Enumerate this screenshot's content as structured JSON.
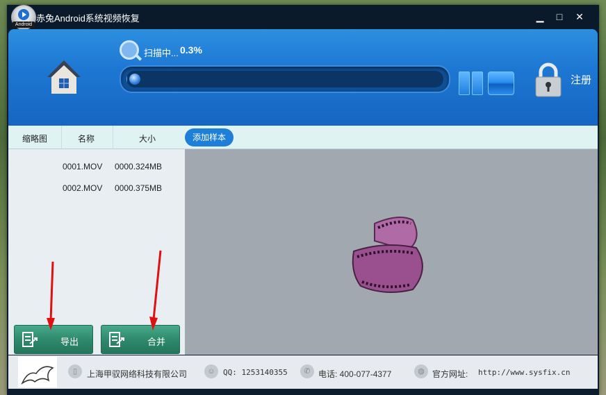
{
  "window": {
    "title": "赤兔Android系统视频恢复",
    "logo_tag": "Android"
  },
  "controls": {
    "minimize": "▁",
    "maximize": "□",
    "close": "✕"
  },
  "scan": {
    "label": "扫描中...",
    "percent": "0.3%",
    "progress": 0.003
  },
  "header": {
    "register_label": "注册"
  },
  "columns": {
    "thumbnail": "缩略图",
    "name": "名称",
    "size": "大小",
    "add_sample": "添加样本"
  },
  "files": [
    {
      "name": "0001.MOV",
      "size": "0000.324MB"
    },
    {
      "name": "0002.MOV",
      "size": "0000.375MB"
    }
  ],
  "buttons": {
    "export": "导出",
    "merge": "合并"
  },
  "footer": {
    "company": "上海甲驭网络科技有限公司",
    "qq": "QQ: 1253140355",
    "phone": "电话: 400-077-4377",
    "website_label": "官方网址:",
    "website": "http://www.sysfix.cn"
  },
  "colors": {
    "accent": "#1d78d3",
    "button_green": "#2f8a6c",
    "annotation": "#e01010"
  }
}
